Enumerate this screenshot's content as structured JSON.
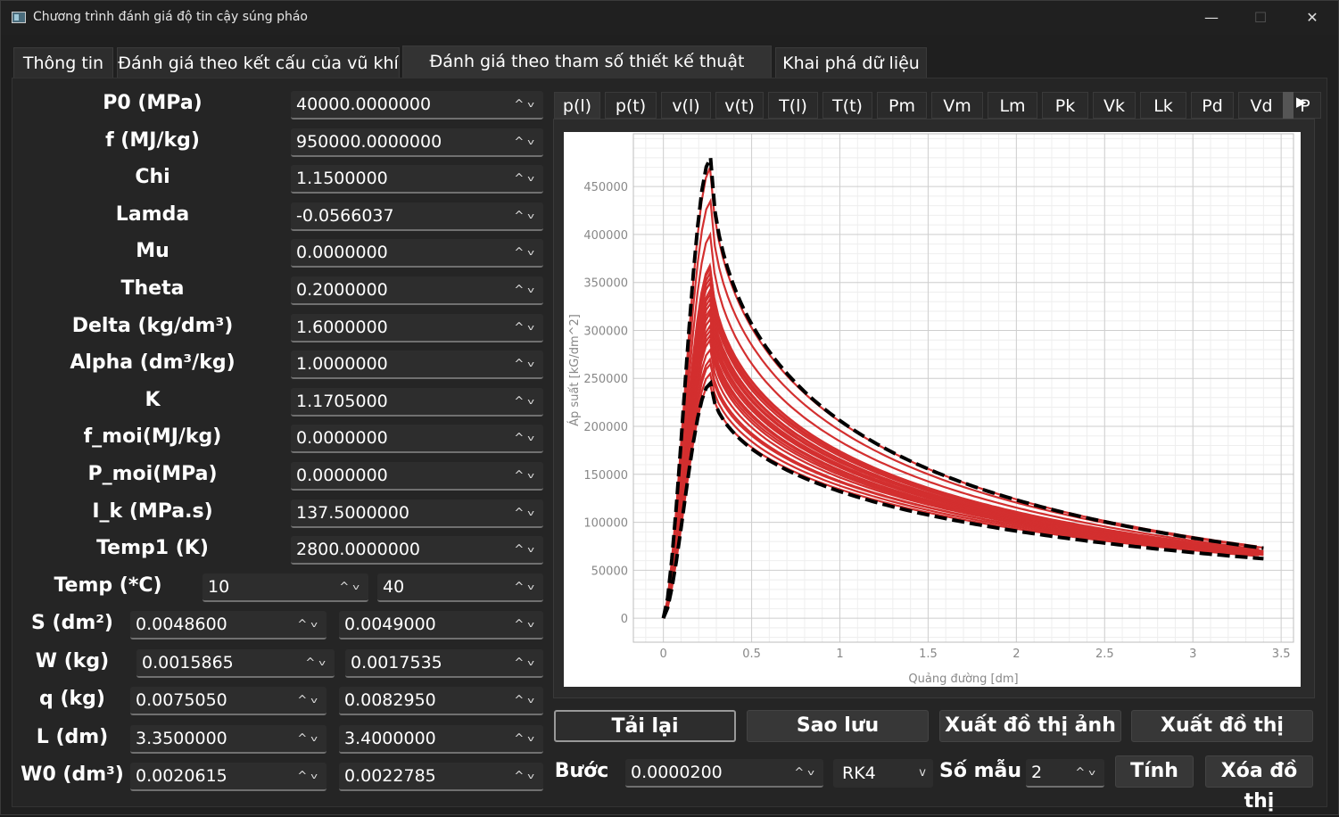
{
  "window": {
    "title": "Chương trình đánh giá độ tin cậy súng pháo",
    "minimize": "—",
    "maximize": "☐",
    "close": "✕"
  },
  "tabs": [
    "Thông tin",
    "Đánh giá theo kết cấu của vũ khí",
    "Đánh giá theo tham số thiết kế thuật phóng",
    "Khai phá dữ liệu"
  ],
  "params": [
    {
      "label": "P0 (MPa)",
      "value": "40000.0000000"
    },
    {
      "label": "f (MJ/kg)",
      "value": "950000.0000000"
    },
    {
      "label": "Chi",
      "value": "1.1500000"
    },
    {
      "label": "Lamda",
      "value": "-0.0566037"
    },
    {
      "label": "Mu",
      "value": "0.0000000"
    },
    {
      "label": "Theta",
      "value": "0.2000000"
    },
    {
      "label": "Delta (kg/dm³)",
      "value": "1.6000000"
    },
    {
      "label": "Alpha (dm³/kg)",
      "value": "1.0000000"
    },
    {
      "label": "K",
      "value": "1.1705000"
    },
    {
      "label": "f_moi(MJ/kg)",
      "value": "0.0000000"
    },
    {
      "label": "P_moi(MPa)",
      "value": "0.0000000"
    },
    {
      "label": "I_k (MPa.s)",
      "value": "137.5000000"
    },
    {
      "label": "Temp1 (K)",
      "value": "2800.0000000"
    }
  ],
  "temp": {
    "label": "Temp (*C)",
    "min": "10",
    "max": "40"
  },
  "ranges": [
    {
      "label": "S (dm²)",
      "min": "0.0048600",
      "max": "0.0049000"
    },
    {
      "label": "W (kg)",
      "min": "0.0015865",
      "max": "0.0017535"
    },
    {
      "label": "q (kg)",
      "min": "0.0075050",
      "max": "0.0082950"
    },
    {
      "label": "L (dm)",
      "min": "3.3500000",
      "max": "3.4000000"
    },
    {
      "label": "W0 (dm³)",
      "min": "0.0020615",
      "max": "0.0022785"
    }
  ],
  "plot_tabs": [
    "p(l)",
    "p(t)",
    "v(l)",
    "v(t)",
    "T(l)",
    "T(t)",
    "Pm",
    "Vm",
    "Lm",
    "Pk",
    "Vk",
    "Lk",
    "Pd",
    "Vd",
    "P"
  ],
  "buttons": {
    "reload": "Tải lại",
    "backup": "Sao lưu",
    "export_image": "Xuất đồ thị ảnh",
    "export_plot": "Xuất đồ thị",
    "compute": "Tính",
    "clear_plot": "Xóa đồ thị"
  },
  "step": {
    "label": "Bước",
    "value": "0.0000200",
    "method": "RK4"
  },
  "samples": {
    "label": "Số mẫu",
    "value": "2"
  },
  "colors": {
    "series": "#d32f2f",
    "envelope": "#000000"
  },
  "chart_data": {
    "type": "line",
    "title": "",
    "xlabel": "Quảng đường [dm]",
    "ylabel": "Áp suất [kG/dm^2]",
    "xlim": [
      -0.17,
      3.57
    ],
    "ylim": [
      -25000,
      505000
    ],
    "xticks": [
      0,
      0.5,
      1,
      1.5,
      2,
      2.5,
      3,
      3.5
    ],
    "yticks": [
      0,
      50000,
      100000,
      150000,
      200000,
      250000,
      300000,
      350000,
      400000,
      450000
    ],
    "grid": true,
    "curve_model": "p(l) = peak * (l/0.27)^0.8 * exp(0.8*(1 - l/0.27))^? ; curves end near x=3.35–3.40",
    "peaks": [
      245000,
      255000,
      265000,
      270000,
      280000,
      290000,
      295000,
      300000,
      305000,
      312000,
      318000,
      322000,
      328000,
      333000,
      338000,
      342000,
      350000,
      355000,
      360000,
      365000,
      368000,
      400000,
      435000,
      470000
    ],
    "envelope_peaks": [
      245000,
      480000
    ],
    "end_values": [
      65000,
      75000
    ]
  }
}
